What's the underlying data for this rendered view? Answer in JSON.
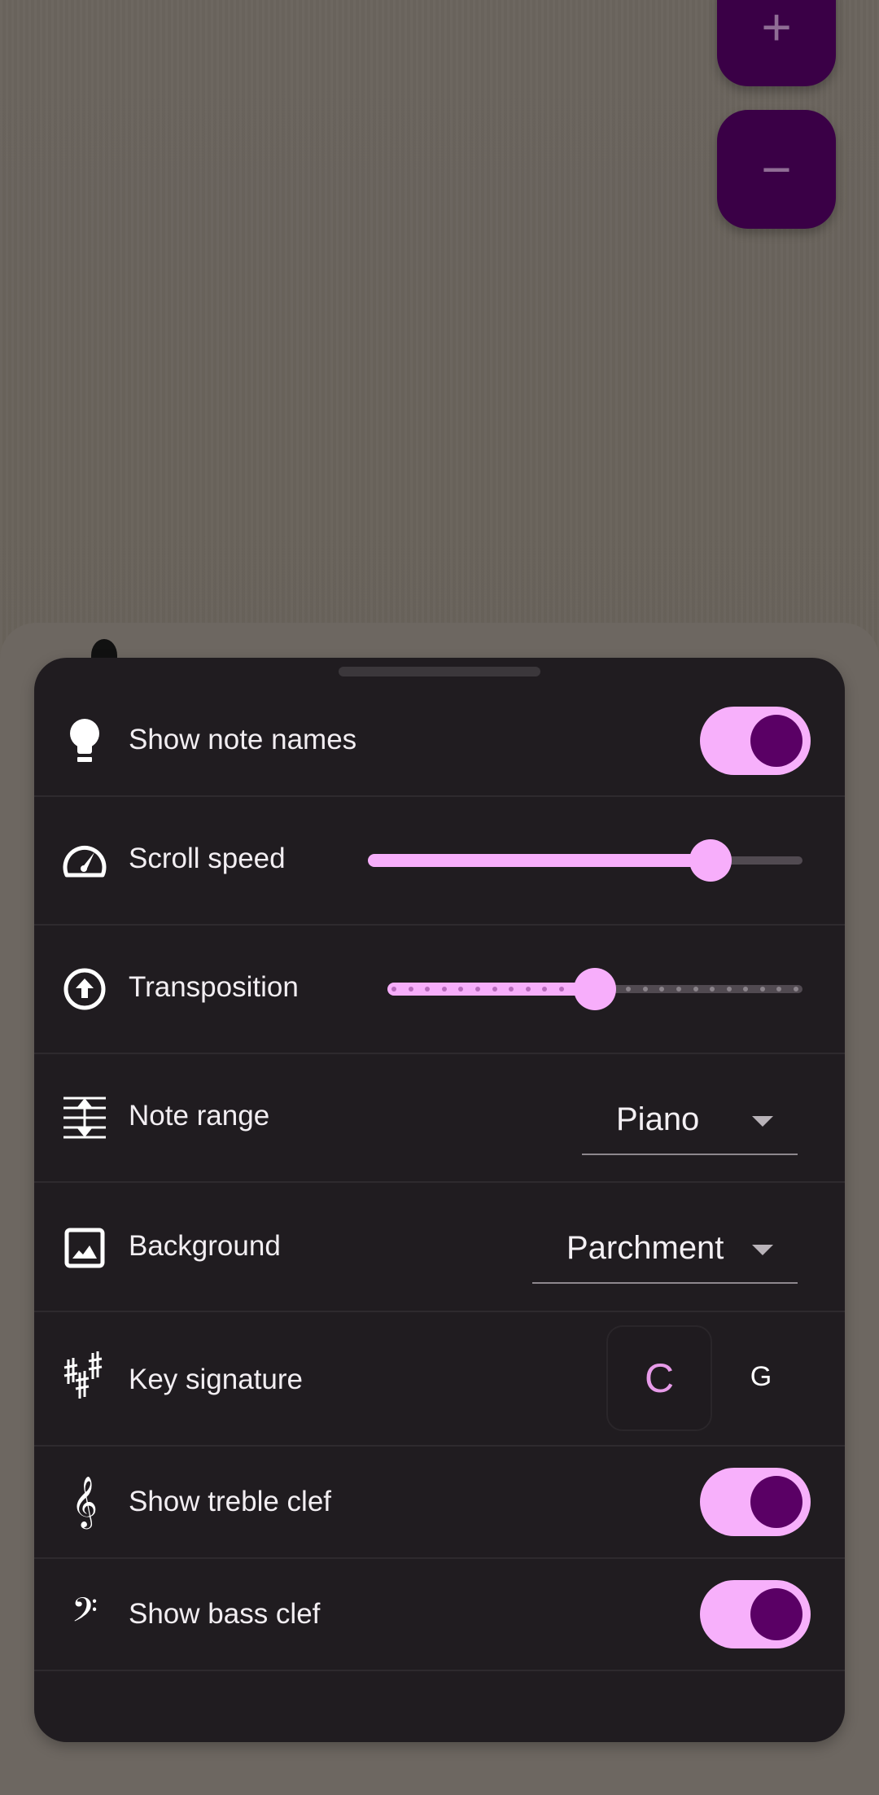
{
  "zoom_controls": {
    "zoom_in_label": "+",
    "zoom_out_label": "−"
  },
  "settings": {
    "show_note_names": {
      "label": "Show note names",
      "icon": "lightbulb-icon",
      "enabled": true
    },
    "scroll_speed": {
      "label": "Scroll speed",
      "icon": "speedometer-icon",
      "value_fraction": 0.82
    },
    "transposition": {
      "label": "Transposition",
      "icon": "arrow-circle-up-icon",
      "min": -12,
      "max": 12,
      "value": 0
    },
    "note_range": {
      "label": "Note range",
      "icon": "staff-height-icon",
      "selected": "Piano"
    },
    "background": {
      "label": "Background",
      "icon": "image-icon",
      "selected": "Parchment"
    },
    "key_signature": {
      "label": "Key signature",
      "icon": "sharps-icon",
      "options": [
        "C",
        "G"
      ],
      "selected": "C"
    },
    "show_treble_clef": {
      "label": "Show treble clef",
      "icon": "treble-clef-icon",
      "glyph": "𝄞",
      "enabled": true
    },
    "show_bass_clef": {
      "label": "Show bass clef",
      "icon": "bass-clef-icon",
      "glyph": "𝄢",
      "enabled": true
    }
  },
  "colors": {
    "accent": "#f7aefb",
    "accent_dark": "#5a0065",
    "fab": "#3a0046",
    "sheet": "#201c20",
    "selected_key_text": "#e79be9"
  }
}
